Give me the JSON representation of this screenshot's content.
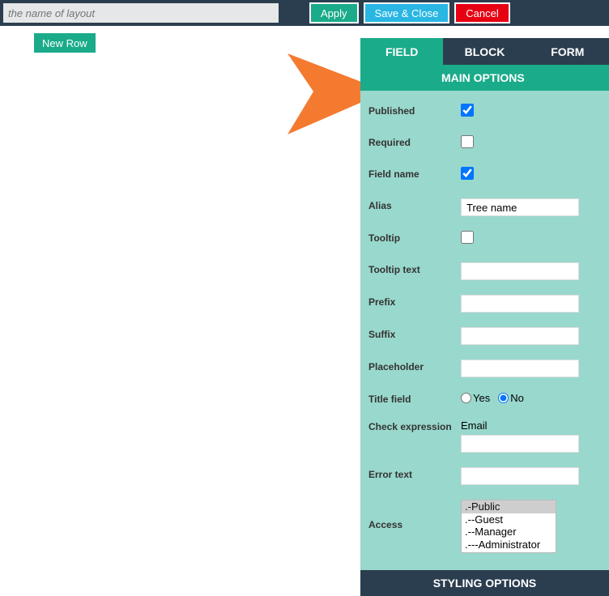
{
  "topbar": {
    "layout_placeholder": "the name of layout",
    "apply": "Apply",
    "save_close": "Save & Close",
    "cancel": "Cancel"
  },
  "workspace": {
    "new_row": "New Row"
  },
  "panel": {
    "tabs": {
      "field": "FIELD",
      "block": "BLOCK",
      "form": "FORM"
    },
    "main_options": "MAIN OPTIONS",
    "styling_options": "STYLING OPTIONS",
    "labels": {
      "published": "Published",
      "required": "Required",
      "field_name": "Field name",
      "alias": "Alias",
      "tooltip": "Tooltip",
      "tooltip_text": "Tooltip text",
      "prefix": "Prefix",
      "suffix": "Suffix",
      "placeholder": "Placeholder",
      "title_field": "Title field",
      "check_expression": "Check expression",
      "error_text": "Error text",
      "access": "Access"
    },
    "values": {
      "alias": "Tree name",
      "tooltip_text": "",
      "prefix": "",
      "suffix": "",
      "placeholder": "",
      "check_expression_static": "Email",
      "check_expression_input": "",
      "error_text": ""
    },
    "title_field": {
      "yes": "Yes",
      "no": "No"
    },
    "access_options": [
      ".-Public",
      ".--Guest",
      ".--Manager",
      ".---Administrator"
    ]
  }
}
